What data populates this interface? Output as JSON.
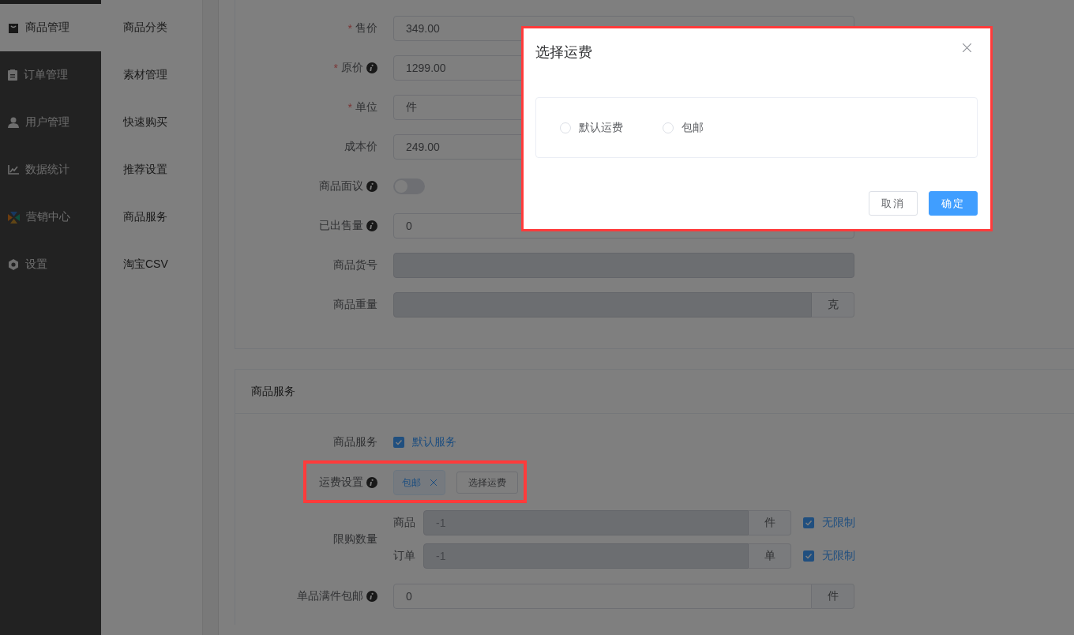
{
  "sidebar": {
    "items": [
      {
        "label": "商品管理",
        "selected": true
      },
      {
        "label": "订单管理",
        "selected": false
      },
      {
        "label": "用户管理",
        "selected": false
      },
      {
        "label": "数据统计",
        "selected": false
      },
      {
        "label": "营销中心",
        "selected": false
      },
      {
        "label": "设置",
        "selected": false
      }
    ]
  },
  "submenu": {
    "items": [
      {
        "label": "商品分类"
      },
      {
        "label": "素材管理"
      },
      {
        "label": "快速购买"
      },
      {
        "label": "推荐设置"
      },
      {
        "label": "商品服务"
      },
      {
        "label": "淘宝CSV"
      }
    ]
  },
  "basic_form": {
    "rows": [
      {
        "kind": "input",
        "required_mark": "*",
        "label": "售价",
        "info": false,
        "value": "349.00",
        "disabled": false
      },
      {
        "kind": "input",
        "required_mark": "*",
        "label": "原价",
        "info": true,
        "value": "1299.00",
        "disabled": false
      },
      {
        "kind": "input",
        "required_mark": "*",
        "label": "单位",
        "info": false,
        "value": "件",
        "disabled": false
      },
      {
        "kind": "input",
        "label": "成本价",
        "info": false,
        "value": "249.00",
        "disabled": false
      },
      {
        "kind": "switch",
        "label": "商品面议",
        "info": true,
        "on": false
      },
      {
        "kind": "input",
        "label": "已出售量",
        "info": true,
        "value": "0",
        "disabled": false
      },
      {
        "kind": "input",
        "label": "商品货号",
        "info": false,
        "disabled": true
      },
      {
        "kind": "input",
        "label": "商品重量",
        "info": false,
        "suffix": "克",
        "disabled": true
      }
    ]
  },
  "service_section": {
    "title": "商品服务",
    "rows": [
      {
        "kind": "checkbox",
        "label": "商品服务",
        "info": false,
        "option": {
          "label": "默认服务",
          "checked": true
        }
      },
      {
        "kind": "shipping",
        "label": "运费设置",
        "info": true,
        "highlighted": true,
        "tag": "包邮",
        "button": "选择运费"
      },
      {
        "kind": "limits",
        "label": "限购数量",
        "info": false,
        "lines": [
          {
            "prefix": "商品",
            "placeholder": "-1",
            "suffix": "件",
            "disabled": true,
            "unlimited": {
              "label": "无限制",
              "checked": true
            }
          },
          {
            "prefix": "订单",
            "placeholder": "-1",
            "suffix": "单",
            "disabled": true,
            "unlimited": {
              "label": "无限制",
              "checked": true
            }
          }
        ]
      },
      {
        "kind": "input",
        "label": "单品满件包邮",
        "info": true,
        "value": "0",
        "suffix": "件",
        "disabled": false
      }
    ]
  },
  "dialog": {
    "title": "选择运费",
    "highlighted": true,
    "options": [
      {
        "label": "默认运费",
        "selected": false
      },
      {
        "label": "包邮",
        "selected": false
      }
    ],
    "buttons": [
      {
        "label": "取消",
        "kind": "default"
      },
      {
        "label": "确定",
        "kind": "primary"
      }
    ]
  }
}
